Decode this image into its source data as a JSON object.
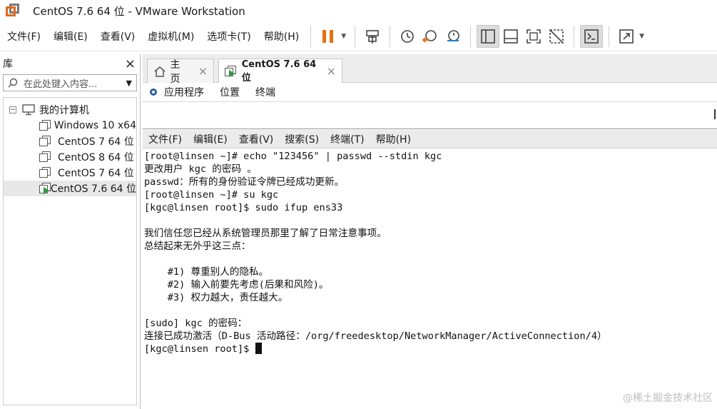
{
  "window": {
    "title": "CentOS 7.6 64 位 - VMware Workstation"
  },
  "menu": {
    "items": [
      "文件(F)",
      "编辑(E)",
      "查看(V)",
      "虚拟机(M)",
      "选项卡(T)",
      "帮助(H)"
    ]
  },
  "toolbar": {
    "icons": [
      "pause-icon",
      "send-keys-icon",
      "snapshot-icon",
      "revert-snapshot-icon",
      "snapshot-manager-icon",
      "library-view-icon",
      "thumbnail-view-icon",
      "fullscreen-icon",
      "unity-icon",
      "console-icon",
      "stretch-icon"
    ],
    "accent": "#e8700f"
  },
  "library": {
    "title": "库",
    "search_placeholder": "在此处键入内容...",
    "root": "我的计算机",
    "vms": [
      "Windows 10 x64",
      "CentOS 7 64 位",
      "CentOS 8 64 位",
      "CentOS 7 64 位",
      "CentOS 7.6 64 位"
    ]
  },
  "tabs": [
    {
      "label": "主页"
    },
    {
      "label": "CentOS 7.6 64 位"
    }
  ],
  "vm_toolbar": {
    "items": [
      "应用程序",
      "位置",
      "终端"
    ]
  },
  "terminal": {
    "menu": [
      "文件(F)",
      "编辑(E)",
      "查看(V)",
      "搜索(S)",
      "终端(T)",
      "帮助(H)"
    ],
    "lines": [
      "[root@linsen ~]# echo \"123456\" | passwd --stdin kgc",
      "更改用户 kgc 的密码 。",
      "passwd：所有的身份验证令牌已经成功更新。",
      "[root@linsen ~]# su kgc",
      "[kgc@linsen root]$ sudo ifup ens33",
      "",
      "我们信任您已经从系统管理员那里了解了日常注意事项。",
      "总结起来无外乎这三点：",
      "",
      "    #1) 尊重别人的隐私。",
      "    #2) 输入前要先考虑(后果和风险)。",
      "    #3) 权力越大，责任越大。",
      "",
      "[sudo] kgc 的密码：",
      "连接已成功激活（D-Bus 活动路径：/org/freedesktop/NetworkManager/ActiveConnection/4）",
      "[kgc@linsen root]$ "
    ]
  },
  "watermark": "@稀土掘金技术社区"
}
